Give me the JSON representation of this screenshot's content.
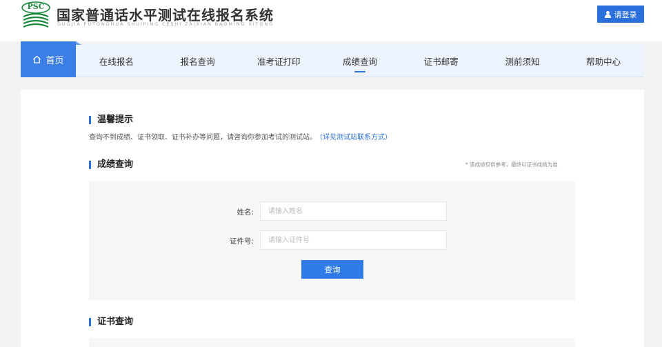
{
  "header": {
    "logo_text": "PSC",
    "title": "国家普通话水平测试在线报名系统",
    "pinyin": "GUOJIA PUTONGHUA SHUIPING CESHI ZAIXIAN BAOMING XITONG",
    "login_label": "请登录",
    "login_icon": "user-icon"
  },
  "nav": {
    "home_label": "首页",
    "home_icon": "home-icon",
    "items": [
      {
        "label": "在线报名",
        "active": false
      },
      {
        "label": "报名查询",
        "active": false
      },
      {
        "label": "准考证打印",
        "active": false
      },
      {
        "label": "成绩查询",
        "active": true
      },
      {
        "label": "证书邮寄",
        "active": false
      },
      {
        "label": "测前须知",
        "active": false
      },
      {
        "label": "帮助中心",
        "active": false
      }
    ]
  },
  "tips": {
    "title": "温馨提示",
    "text": "查询不到成绩、证书领取、证书补办等问题，请咨询你参加考试的测试站。",
    "link": "（详见测试站联系方式）"
  },
  "score_query": {
    "title": "成绩查询",
    "note": "* 该成绩仅供参考，最终以证书成绩为准",
    "name_label": "姓名:",
    "name_placeholder": "请输入姓名",
    "id_label": "证件号:",
    "id_placeholder": "请输入证件号",
    "submit_label": "查询"
  },
  "cert_query": {
    "title": "证书查询"
  },
  "colors": {
    "primary": "#2a6fdb",
    "nav_bg": "#edf3fc",
    "home_bg": "#3a7ee6",
    "page_bg": "#f2f3f5",
    "logo_green": "#1a8a3a"
  }
}
